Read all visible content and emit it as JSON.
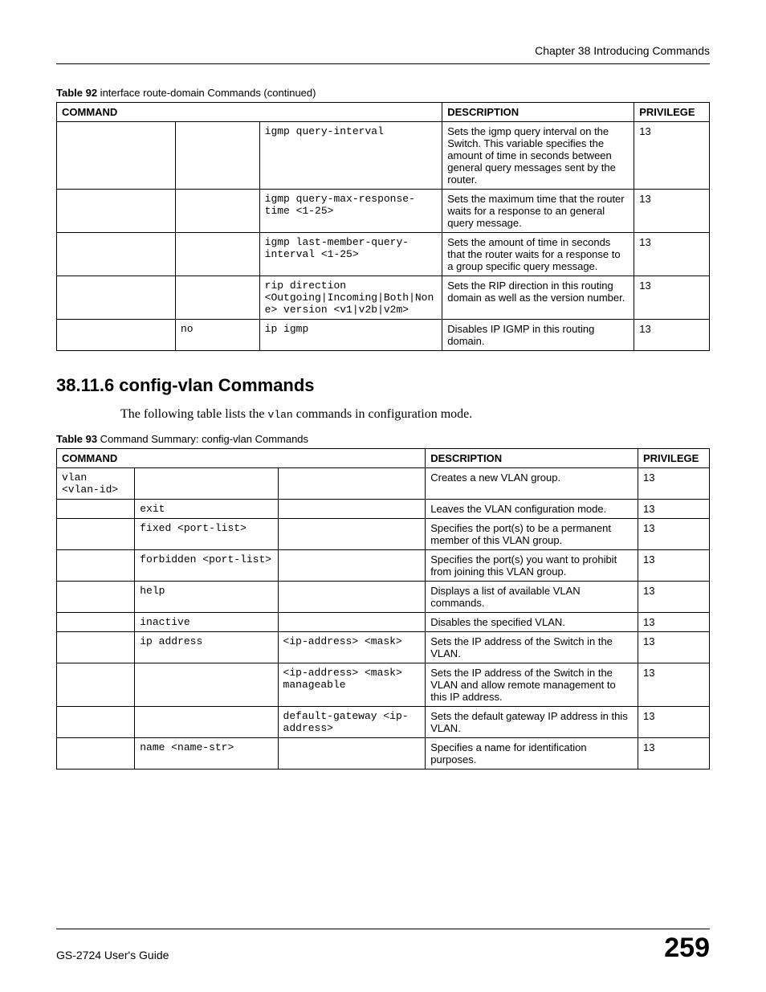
{
  "chapter_header": "Chapter 38 Introducing Commands",
  "table92": {
    "caption_bold": "Table 92",
    "caption_rest": "   interface route-domain Commands (continued)",
    "headers": {
      "command": "COMMAND",
      "description": "DESCRIPTION",
      "privilege": "PRIVILEGE"
    },
    "rows": [
      {
        "c1": "",
        "c2": "",
        "c3": "igmp query-interval",
        "desc": "Sets the igmp query interval on the Switch. This variable specifies the amount of time in seconds between general query messages sent by the router.",
        "priv": "13"
      },
      {
        "c1": "",
        "c2": "",
        "c3": "igmp query-max-response-time <1-25>",
        "desc": "Sets the maximum time that the router waits for a response to an general query message.",
        "priv": "13"
      },
      {
        "c1": "",
        "c2": "",
        "c3": "igmp last-member-query-interval <1-25>",
        "desc": "Sets the amount of time in seconds that the router waits for a response to a group specific query message.",
        "priv": "13"
      },
      {
        "c1": "",
        "c2": "",
        "c3": "rip direction <Outgoing|Incoming|Both|None> version <v1|v2b|v2m>",
        "desc": "Sets the RIP direction in this routing domain as well as the version number.",
        "priv": "13"
      },
      {
        "c1": "",
        "c2": "no",
        "c3": "ip igmp",
        "desc": "Disables IP IGMP in this routing domain.",
        "priv": "13"
      }
    ]
  },
  "section": {
    "number_title": "38.11.6  config-vlan Commands",
    "intro_pre": "The following table lists the ",
    "intro_code": "vlan",
    "intro_post": " commands in configuration mode."
  },
  "table93": {
    "caption_bold": "Table 93",
    "caption_rest": "   Command Summary: config-vlan Commands",
    "headers": {
      "command": "COMMAND",
      "description": "DESCRIPTION",
      "privilege": "PRIVILEGE"
    },
    "rows": [
      {
        "c1": "vlan <vlan-id>",
        "c2": "",
        "c3": "",
        "desc": "Creates a new VLAN group.",
        "priv": "13"
      },
      {
        "c1": "",
        "c2": "exit",
        "c3": "",
        "desc": "Leaves the VLAN configuration mode.",
        "priv": "13"
      },
      {
        "c1": "",
        "c2": "fixed <port-list>",
        "c3": "",
        "desc": "Specifies the port(s) to be a permanent member of this VLAN group.",
        "priv": "13"
      },
      {
        "c1": "",
        "c2": "forbidden <port-list>",
        "c3": "",
        "desc": "Specifies the port(s) you want to prohibit from joining this VLAN group.",
        "priv": "13"
      },
      {
        "c1": "",
        "c2": "help",
        "c3": "",
        "desc": "Displays a list of available VLAN commands.",
        "priv": "13"
      },
      {
        "c1": "",
        "c2": "inactive",
        "c3": "",
        "desc": "Disables the specified VLAN.",
        "priv": "13"
      },
      {
        "c1": "",
        "c2": "ip address",
        "c3": "<ip-address> <mask>",
        "desc": "Sets the IP address of the Switch in the VLAN.",
        "priv": "13"
      },
      {
        "c1": "",
        "c2": "",
        "c3": "<ip-address> <mask> manageable",
        "desc": "Sets the IP address of the Switch in the VLAN and allow remote management to this IP address.",
        "priv": "13"
      },
      {
        "c1": "",
        "c2": "",
        "c3": "default-gateway <ip-address>",
        "desc": "Sets the default gateway IP address in this VLAN.",
        "priv": "13"
      },
      {
        "c1": "",
        "c2": "name <name-str>",
        "c3": "",
        "desc": "Specifies a name for identification purposes.",
        "priv": "13"
      }
    ]
  },
  "footer": {
    "left": "GS-2724 User's Guide",
    "right": "259"
  }
}
